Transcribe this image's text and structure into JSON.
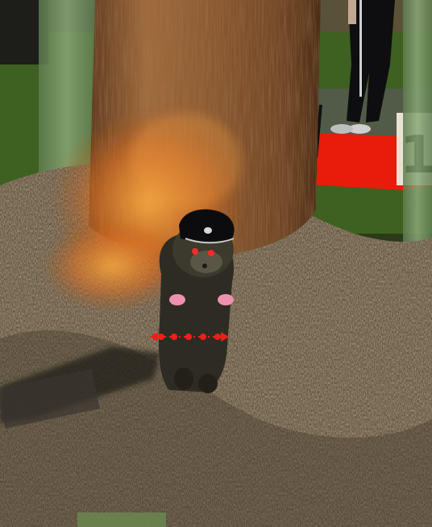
{
  "scene": {
    "sign_text": "1"
  },
  "colors": {
    "grass": "#3a5a1e",
    "grass_dark": "#2c4216",
    "hay": "#7a6a52",
    "hay_dark": "#4a3e2e",
    "tree_trunk": "#8a5a34",
    "fire_glow": "#e8842a",
    "red_carpet": "#e81c0a",
    "selection_dots": "#ff1a1a",
    "pillar_green": "#7e9a6a"
  },
  "icons": {
    "selection": "move-arrows-icon",
    "sign": "number-sign-icon"
  }
}
